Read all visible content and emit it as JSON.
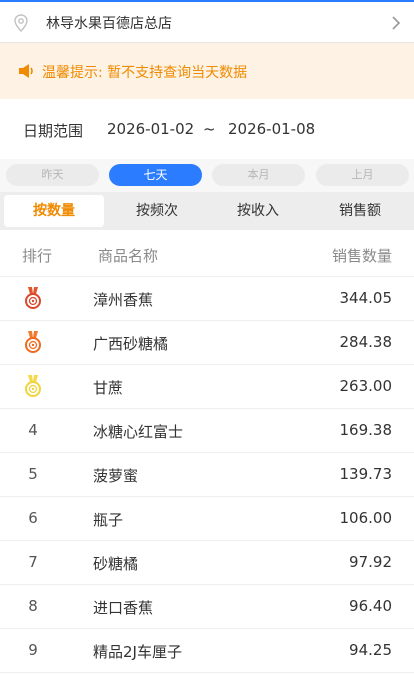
{
  "store": {
    "name": "林导水果百德店总店"
  },
  "notice": {
    "text": "温馨提示: 暂不支持查询当天数据"
  },
  "date_range": {
    "label": "日期范围",
    "start": "2026-01-02",
    "separator": "~",
    "end": "2026-01-08"
  },
  "quick_ranges": [
    {
      "label": "昨天",
      "active": false
    },
    {
      "label": "七天",
      "active": true
    },
    {
      "label": "本月",
      "active": false
    },
    {
      "label": "上月",
      "active": false
    }
  ],
  "tabs": [
    {
      "label": "按数量",
      "active": true
    },
    {
      "label": "按频次",
      "active": false
    },
    {
      "label": "按收入",
      "active": false
    },
    {
      "label": "销售额",
      "active": false
    }
  ],
  "table": {
    "headers": {
      "rank": "排行",
      "name": "商品名称",
      "qty": "销售数量"
    },
    "rows": [
      {
        "rank": "1",
        "medal": "gold-medal-icon",
        "name": "漳州香蕉",
        "qty": "344.05"
      },
      {
        "rank": "2",
        "medal": "silver-medal-icon",
        "name": "广西砂糖橘",
        "qty": "284.38"
      },
      {
        "rank": "3",
        "medal": "bronze-medal-icon",
        "name": "甘蔗",
        "qty": "263.00"
      },
      {
        "rank": "4",
        "name": "冰糖心红富士",
        "qty": "169.38"
      },
      {
        "rank": "5",
        "name": "菠萝蜜",
        "qty": "139.73"
      },
      {
        "rank": "6",
        "name": "瓶子",
        "qty": "106.00"
      },
      {
        "rank": "7",
        "name": "砂糖橘",
        "qty": "97.92"
      },
      {
        "rank": "8",
        "name": "进口香蕉",
        "qty": "96.40"
      },
      {
        "rank": "9",
        "name": "精品2J车厘子",
        "qty": "94.25"
      }
    ]
  },
  "colors": {
    "accent_blue": "#2b7cff",
    "accent_orange": "#f08a00",
    "notice_bg": "#fdf2e3"
  }
}
